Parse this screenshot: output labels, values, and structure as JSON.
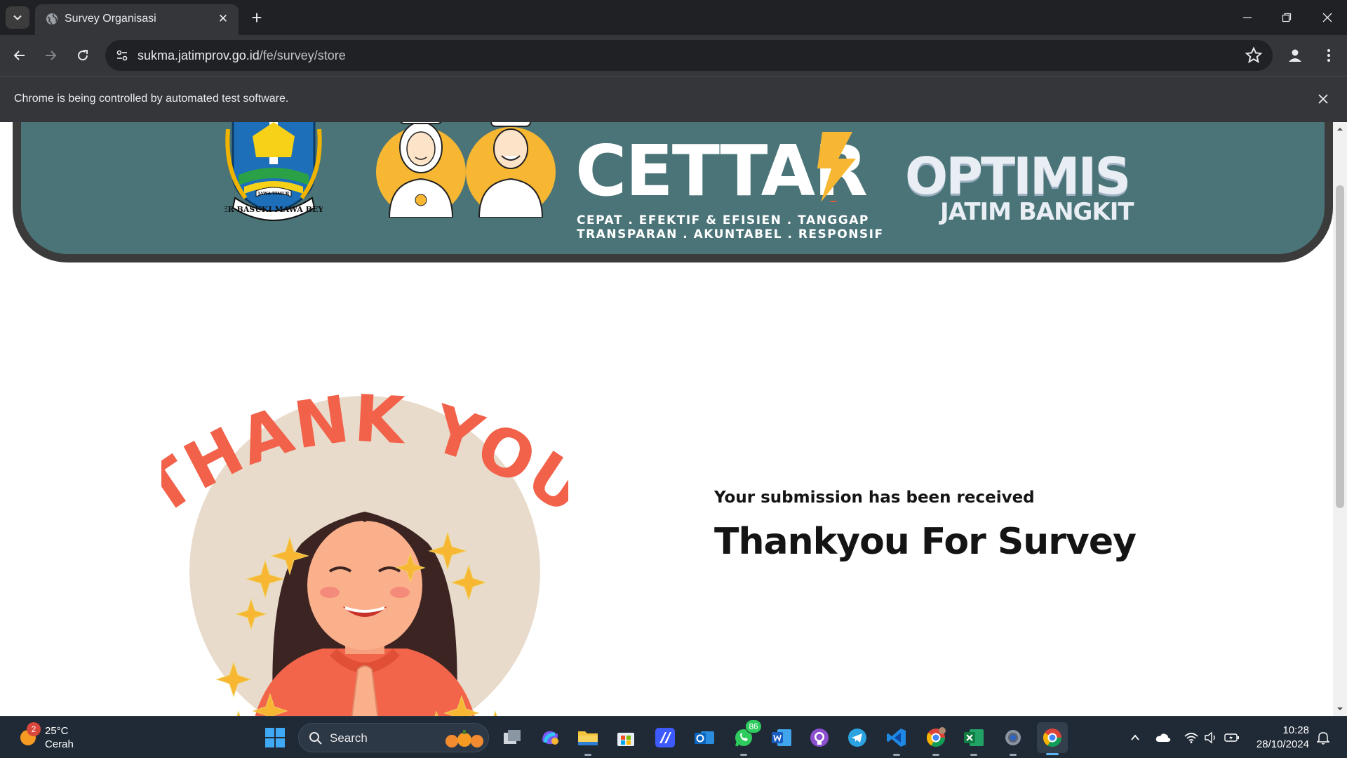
{
  "browser": {
    "tab_title": "Survey Organisasi",
    "url_host": "sukma.jatimprov.go.id",
    "url_path": "/fe/survey/store",
    "infobar_text": "Chrome is being controlled by automated test software."
  },
  "banner": {
    "cettar_tagline_1": "CEPAT . EFEKTIF & EFISIEN . TANGGAP",
    "cettar_tagline_2": "TRANSPARAN . AKUNTABEL . RESPONSIF",
    "optimis": "OPTIMIS",
    "jatim_bangkit": "JATIM BANGKIT",
    "crest_caption": "JER BASUKI MAWA BEYA",
    "crest_top": "JAWA TIMUR",
    "cettar_logo": "CETTAR"
  },
  "content": {
    "thank_you_art": "THANK YOU",
    "submission_message": "Your submission has been received",
    "headline": "Thankyou For Survey"
  },
  "taskbar": {
    "weather_badge": "2",
    "weather_temp": "25°C",
    "weather_condition": "Cerah",
    "search_label": "Search",
    "whatsapp_badge": "86",
    "time": "10:28",
    "date": "28/10/2024"
  },
  "colors": {
    "banner_teal": "#4a7478",
    "thank_you_coral": "#f2614a",
    "accent_yellow": "#f7b733"
  }
}
